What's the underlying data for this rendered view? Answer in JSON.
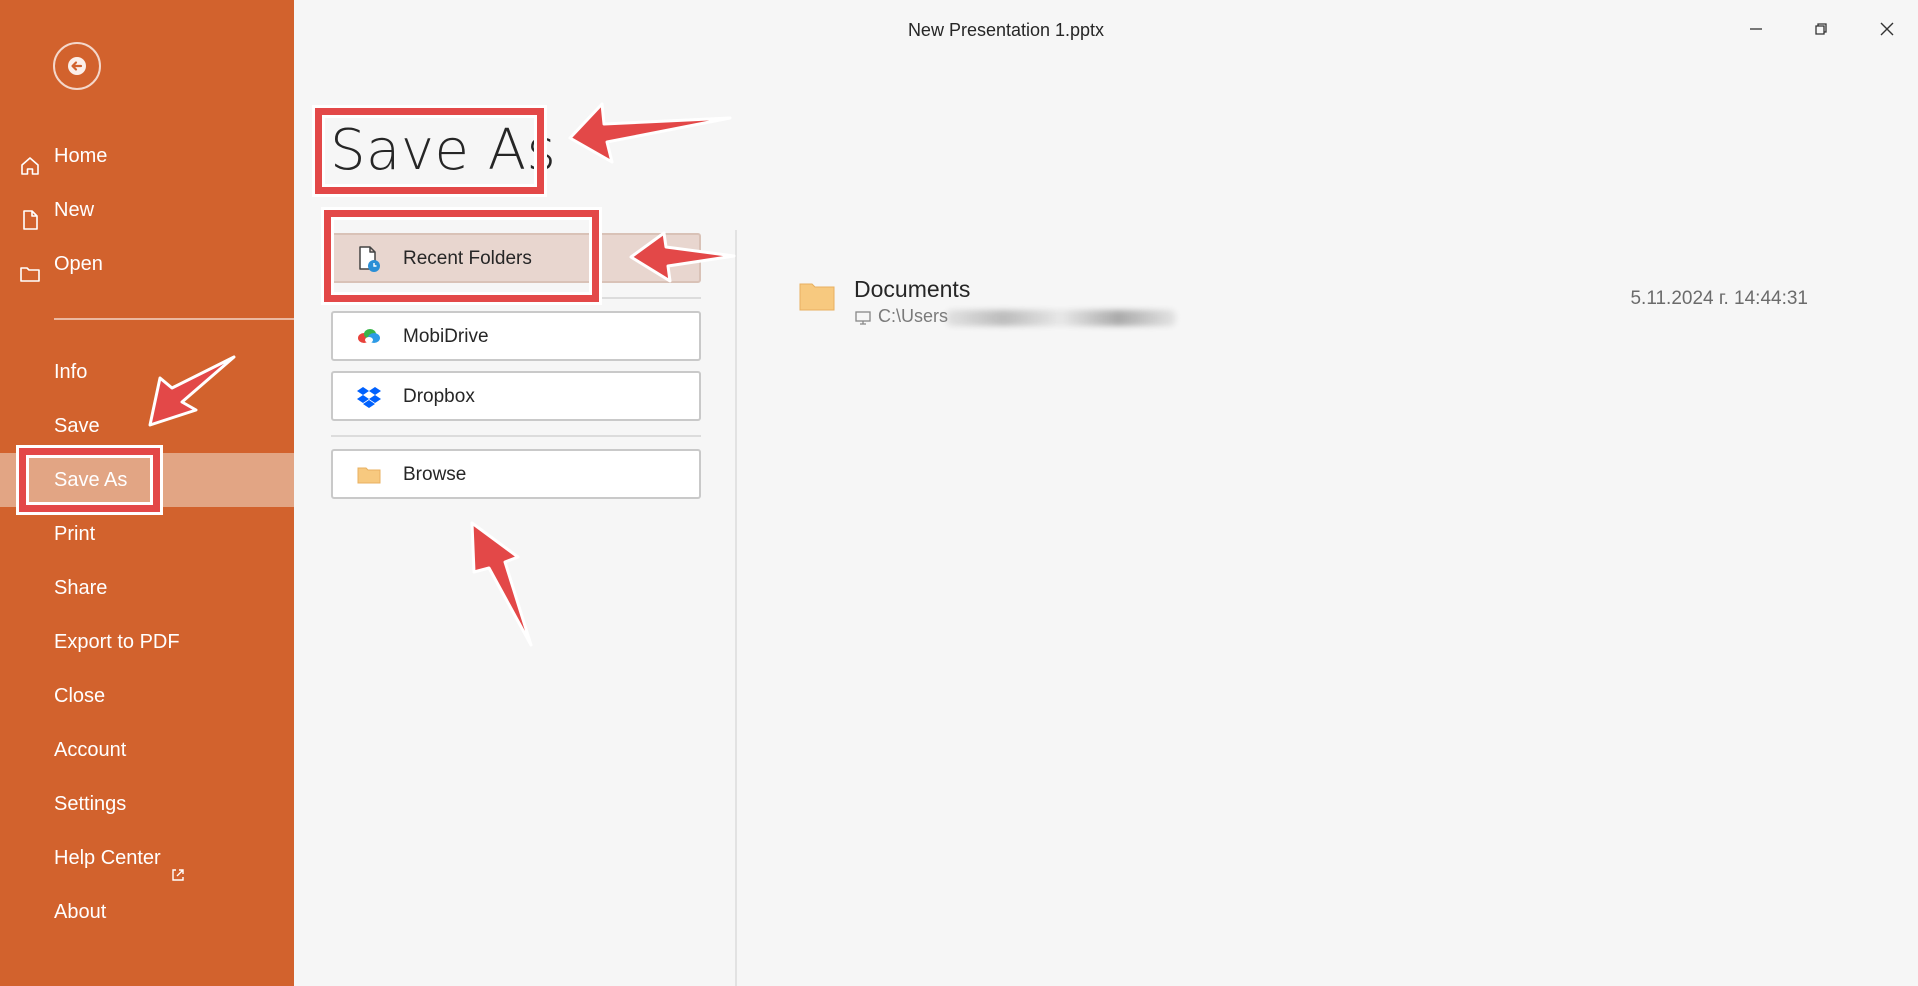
{
  "window": {
    "title": "New Presentation 1.pptx",
    "controls": [
      "minimize-icon",
      "restore-icon",
      "close-icon"
    ]
  },
  "sidebar": {
    "back_icon": "back-arrow-icon",
    "items_top": [
      {
        "label": "Home",
        "icon": "home-icon"
      },
      {
        "label": "New",
        "icon": "new-file-icon"
      },
      {
        "label": "Open",
        "icon": "folder-open-icon"
      }
    ],
    "items": [
      {
        "label": "Info"
      },
      {
        "label": "Save"
      },
      {
        "label": "Save As",
        "selected": true
      },
      {
        "label": "Print"
      },
      {
        "label": "Share"
      },
      {
        "label": "Export to PDF"
      },
      {
        "label": "Close"
      },
      {
        "label": "Account"
      },
      {
        "label": "Settings"
      },
      {
        "label": "Help Center",
        "icon": "external-link-icon"
      },
      {
        "label": "About"
      }
    ]
  },
  "main": {
    "heading": "Save As",
    "locations": [
      {
        "label": "Recent Folders",
        "icon": "recent-document-icon",
        "selected": true
      },
      {
        "label": "MobiDrive",
        "icon": "mobidrive-icon"
      },
      {
        "label": "Dropbox",
        "icon": "dropbox-icon"
      },
      {
        "label": "Browse",
        "icon": "folder-icon"
      }
    ],
    "recent_folders": [
      {
        "name": "Documents",
        "path": "C:\\Users",
        "date": "5.11.2024 г. 14:44:31",
        "icon": "folder-icon",
        "path_icon": "computer-icon"
      }
    ]
  },
  "colors": {
    "sidebar": "#d2622d",
    "sidebar_selected": "#e2a584",
    "location_selected": "#e8d6cf",
    "annotation": "#e34848",
    "folder": "#f7c97f"
  }
}
